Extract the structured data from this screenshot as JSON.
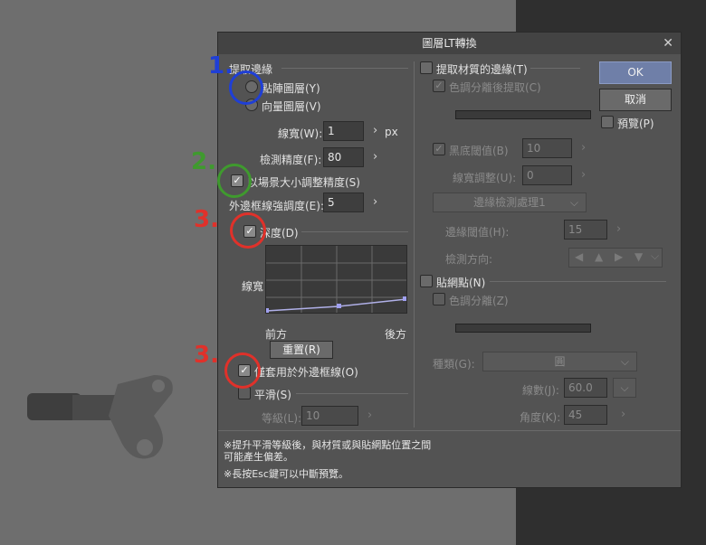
{
  "dialog": {
    "title": "圖層LT轉換",
    "close_glyph": "✕",
    "extract_lines": {
      "heading": "提取邊緣",
      "raster_radio": "點陣圖層(Y)",
      "vector_radio": "向量圖層(V)",
      "line_width_label": "線寬(W):",
      "line_width_value": "1",
      "line_width_unit": "px",
      "detect_label": "檢測精度(F):",
      "detect_value": "80",
      "limit_label": "以場景大小調整精度(S)",
      "outer_label": "外邊框線強調度(E):",
      "outer_value": "5",
      "depth_label": "深度(D)",
      "graph_y_label": "線寬",
      "graph_front": "前方",
      "graph_back": "後方",
      "reset_label": "重置(R)",
      "apply_outer_label": "僅套用於外邊框線(O)",
      "smooth_label": "平滑(S)",
      "smooth_level_label": "等級(L):",
      "smooth_level_value": "10"
    },
    "material": {
      "extract_label": "提取材質的邊緣(T)",
      "color_sep_label": "色調分離後提取(C)",
      "black_thresh_label": "黑底閾值(B)",
      "black_thresh_value": "10",
      "line_adjust_label": "線寬調整(U):",
      "line_adjust_value": "0",
      "edge_select": "邊緣檢測處理1",
      "edge_thresh_label": "邊緣閾值(H):",
      "edge_thresh_value": "15",
      "direction_label": "檢測方向:"
    },
    "halftone": {
      "label": "貼網點(N)",
      "color_sep_label": "色調分離(Z)",
      "type_label": "種類(G):",
      "type_value": "圓",
      "lines_label": "線數(J):",
      "lines_value": "60.0",
      "angle_label": "角度(K):",
      "angle_value": "45"
    },
    "buttons": {
      "ok": "OK",
      "cancel": "取消",
      "preview": "預覽(P)"
    },
    "notes": {
      "note1_line1": "※提升平滑等級後，與材質或與貼網點位置之間",
      "note1_line2": "可能產生偏差。",
      "note2": "※長按Esc鍵可以中斷預覽。"
    }
  },
  "markers": {
    "m1": "1.",
    "m2": "2.",
    "m3a": "3.",
    "m3b": "3.",
    "colors": {
      "blue": "#1f3fd6",
      "green": "#3f9a2e",
      "red": "#e0312a"
    }
  },
  "icons": {
    "chevron": "›",
    "check": "✓",
    "dropdown": "⌵"
  }
}
